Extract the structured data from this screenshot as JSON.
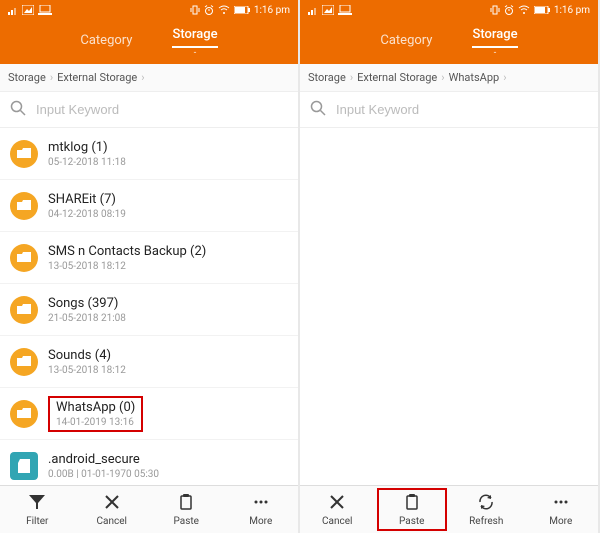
{
  "colors": {
    "accent": "#ed6c00",
    "highlight": "#d40000"
  },
  "status": {
    "time": "1:16 pm"
  },
  "header": {
    "tab_category": "Category",
    "tab_storage": "Storage",
    "sub": "-"
  },
  "left": {
    "breadcrumb": [
      "Storage",
      "External Storage"
    ],
    "search_placeholder": "Input Keyword",
    "items": [
      {
        "name": "mtklog (1)",
        "meta": "05-12-2018 11:18",
        "type": "folder"
      },
      {
        "name": "SHAREit (7)",
        "meta": "04-12-2018 08:19",
        "type": "folder"
      },
      {
        "name": "SMS n Contacts Backup (2)",
        "meta": "13-05-2018 18:12",
        "type": "folder"
      },
      {
        "name": "Songs (397)",
        "meta": "21-05-2018 21:08",
        "type": "folder"
      },
      {
        "name": "Sounds (4)",
        "meta": "13-05-2018 18:12",
        "type": "folder"
      },
      {
        "name": "WhatsApp (0)",
        "meta": "14-01-2019 13:16",
        "type": "folder",
        "highlight": true
      },
      {
        "name": ".android_secure",
        "meta": "0.00B | 01-01-1970 05:30",
        "type": "sd"
      }
    ],
    "bottom": [
      {
        "label": "Filter",
        "icon": "filter"
      },
      {
        "label": "Cancel",
        "icon": "close"
      },
      {
        "label": "Paste",
        "icon": "clipboard"
      },
      {
        "label": "More",
        "icon": "more"
      }
    ]
  },
  "right": {
    "breadcrumb": [
      "Storage",
      "External Storage",
      "WhatsApp"
    ],
    "search_placeholder": "Input Keyword",
    "items": [],
    "bottom": [
      {
        "label": "Cancel",
        "icon": "close"
      },
      {
        "label": "Paste",
        "icon": "clipboard",
        "highlight": true
      },
      {
        "label": "Refresh",
        "icon": "refresh"
      },
      {
        "label": "More",
        "icon": "more"
      }
    ]
  }
}
